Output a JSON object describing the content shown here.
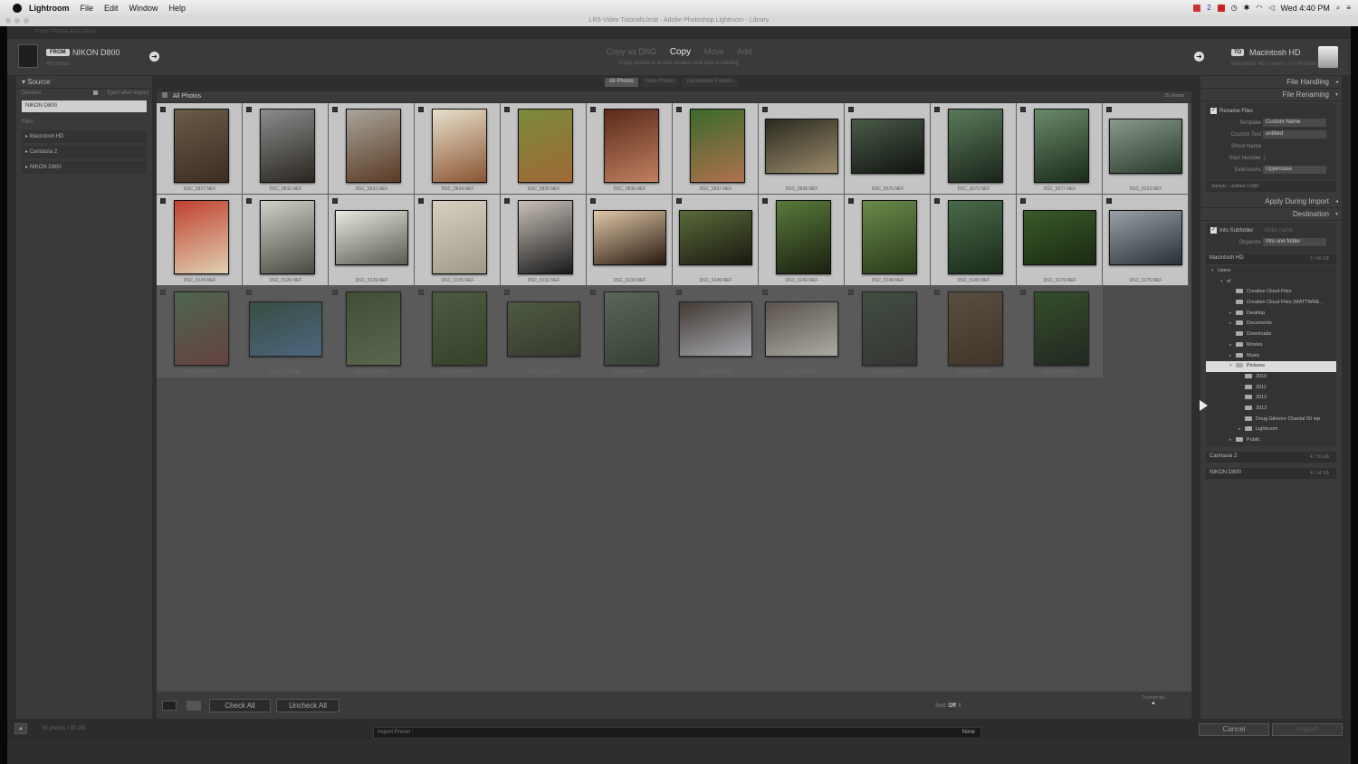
{
  "menubar": {
    "items": [
      "Lightroom",
      "File",
      "Edit",
      "Window",
      "Help"
    ],
    "clock": "Wed 4:40 PM",
    "badge": "2"
  },
  "window": {
    "title": "LR5-Video Tutorials.lrcat - Adobe Photoshop Lightroom - Library"
  },
  "topstrip": {
    "text": "Import Photos and Videos"
  },
  "header": {
    "from_tag": "FROM",
    "from_source": "NIKON D800",
    "from_sub": "All photos",
    "modes": [
      "Copy as DNG",
      "Copy",
      "Move",
      "Add"
    ],
    "active_mode": "Copy",
    "mode_desc": "Copy photos to a new location and add to catalog",
    "to_tag": "TO",
    "to_dest": "Macintosh HD",
    "to_sub": "Macintosh HD / Users / sf / Pictures"
  },
  "source_panel": {
    "title": "Source",
    "devices_label": "Devices",
    "eject_label": "Eject after import",
    "selected_device": "NIKON D800",
    "files_label": "Files",
    "volumes": [
      "Macintosh HD",
      "Camtasia 2",
      "NIKON D800"
    ]
  },
  "grid": {
    "view_tabs": [
      "All Photos",
      "New Photos",
      "Destination Folders"
    ],
    "active_tab": "All Photos",
    "header_label": "All Photos",
    "count": "35 photos",
    "photos": [
      {
        "name": "DSC_5827.NEF",
        "o": "p",
        "c1": "#6a5a48",
        "c2": "#3b2e22",
        "checked": true
      },
      {
        "name": "DSC_5832.NEF",
        "o": "p",
        "c1": "#8a8d8c",
        "c2": "#2a2520",
        "checked": true
      },
      {
        "name": "DSC_5833.NEF",
        "o": "p",
        "c1": "#a8a49a",
        "c2": "#5a3a24",
        "checked": true
      },
      {
        "name": "DSC_5834.NEF",
        "o": "p",
        "c1": "#e8e0cc",
        "c2": "#8a5532",
        "checked": true
      },
      {
        "name": "DSC_5835.NEF",
        "o": "p",
        "c1": "#7a8a3a",
        "c2": "#a06838",
        "checked": true
      },
      {
        "name": "DSC_5836.NEF",
        "o": "p",
        "c1": "#5a2a1a",
        "c2": "#c08060",
        "checked": true
      },
      {
        "name": "DSC_5837.NEF",
        "o": "p",
        "c1": "#3a6a2a",
        "c2": "#b07050",
        "checked": true
      },
      {
        "name": "DSC_5838.NEF",
        "o": "l",
        "c1": "#2a2a20",
        "c2": "#9a8a6a",
        "checked": true
      },
      {
        "name": "DSC_6070.NEF",
        "o": "l",
        "c1": "#4a5a48",
        "c2": "#101410",
        "checked": true
      },
      {
        "name": "DSC_6072.NEF",
        "o": "p",
        "c1": "#5a7a5a",
        "c2": "#1a241a",
        "checked": true
      },
      {
        "name": "DSC_6077.NEF",
        "o": "p",
        "c1": "#6a8a6a",
        "c2": "#1a2a1a",
        "checked": true
      },
      {
        "name": "DSC_6123.NEF",
        "o": "l",
        "c1": "#8a9a8a",
        "c2": "#2a3a2a",
        "checked": true
      },
      {
        "name": "DSC_6124.NEF",
        "o": "p",
        "c1": "#c04030",
        "c2": "#e0d0b0",
        "checked": true
      },
      {
        "name": "DSC_6126.NEF",
        "o": "p",
        "c1": "#d0d0c8",
        "c2": "#4a4a40",
        "checked": true
      },
      {
        "name": "DSC_6129.NEF",
        "o": "l",
        "c1": "#e8e8e0",
        "c2": "#5a5a50",
        "checked": true
      },
      {
        "name": "DSC_6130.NEF",
        "o": "p",
        "c1": "#d8d0c0",
        "c2": "#a09888",
        "checked": true
      },
      {
        "name": "DSC_6132.NEF",
        "o": "p",
        "c1": "#c8c0b8",
        "c2": "#1a1a1a",
        "checked": true
      },
      {
        "name": "DSC_6133.NEF",
        "o": "l",
        "c1": "#e0c8a8",
        "c2": "#2a1a10",
        "checked": true
      },
      {
        "name": "DSC_6140.NEF",
        "o": "l",
        "c1": "#5a6a3a",
        "c2": "#1a1a10",
        "checked": true
      },
      {
        "name": "DSC_6142.NEF",
        "o": "p",
        "c1": "#5a7a3a",
        "c2": "#1a2010",
        "checked": true
      },
      {
        "name": "DSC_6148.NEF",
        "o": "p",
        "c1": "#6a8a4a",
        "c2": "#2a3a1a",
        "checked": true
      },
      {
        "name": "DSC_6165.NEF",
        "o": "p",
        "c1": "#4a6a4a",
        "c2": "#1a2a1a",
        "checked": true
      },
      {
        "name": "DSC_6170.NEF",
        "o": "l",
        "c1": "#3a5a2a",
        "c2": "#1a2a10",
        "checked": true
      },
      {
        "name": "DSC_6175.NEF",
        "o": "l",
        "c1": "#9aa0a8",
        "c2": "#2a3038",
        "checked": true
      },
      {
        "name": "DSC_7165.NEF",
        "o": "p",
        "c1": "#4a6a4a",
        "c2": "#6a3a3a",
        "checked": false
      },
      {
        "name": "DSC_7173.NEF",
        "o": "l",
        "c1": "#2a4a3a",
        "c2": "#4a6a8a",
        "checked": false
      },
      {
        "name": "DSC_7176.NEF",
        "o": "p",
        "c1": "#3a4a2a",
        "c2": "#5a6a4a",
        "checked": false
      },
      {
        "name": "DSC_7184.NEF",
        "o": "p",
        "c1": "#4a5a3a",
        "c2": "#2a3a1a",
        "checked": false
      },
      {
        "name": "DSC_7191.NEF",
        "o": "l",
        "c1": "#4a5a3a",
        "c2": "#2a3020",
        "checked": false
      },
      {
        "name": "DSC_7194.NEF",
        "o": "p",
        "c1": "#5a6a5a",
        "c2": "#2a3a2a",
        "checked": false
      },
      {
        "name": "DSC_7210.NEF",
        "o": "l",
        "c1": "#3a3028",
        "c2": "#c0c0c8",
        "checked": false
      },
      {
        "name": "DSC_7215.NEF",
        "o": "l",
        "c1": "#5a5048",
        "c2": "#c8c4bc",
        "checked": false
      },
      {
        "name": "DSC_7229.NEF",
        "o": "p",
        "c1": "#3a4a3a",
        "c2": "#2a2a28",
        "checked": false
      },
      {
        "name": "DSC_7238.NEF",
        "o": "p",
        "c1": "#5a4a3a",
        "c2": "#3a2a1a",
        "checked": false
      },
      {
        "name": "DSC_7242.NEF",
        "o": "p",
        "c1": "#2a4a1a",
        "c2": "#101810",
        "checked": false
      }
    ]
  },
  "toolbar": {
    "check_all": "Check All",
    "uncheck_all": "Uncheck All",
    "sort_label": "Sort:",
    "sort_value": "Off",
    "thumbnails_label": "Thumbnails"
  },
  "right_panel": {
    "file_handling": "File Handling",
    "file_renaming": "File Renaming",
    "rename_files": "Rename Files",
    "template_label": "Template",
    "template_value": "Custom Name",
    "custom_text_label": "Custom Text",
    "custom_text_value": "untitled",
    "shoot_name_label": "Shoot Name",
    "start_number_label": "Start Number",
    "start_number_value": "1",
    "extensions_label": "Extensions",
    "extensions_value": "Uppercase",
    "sample": "Sample : untitled-1.NEF",
    "apply_during_import": "Apply During Import",
    "destination": "Destination",
    "into_subfolder": "Into Subfolder",
    "subfolder_placeholder": "Enter name",
    "organize_label": "Organize",
    "organize_value": "Into one folder",
    "volumes": [
      {
        "name": "Macintosh HD",
        "size": "2 / 40 GB"
      },
      {
        "name": "Camtasia 2",
        "size": "4 / 36 GB"
      },
      {
        "name": "NIKON D800",
        "size": "4 / 14 GB"
      }
    ],
    "tree": [
      {
        "label": "Users",
        "depth": 0,
        "tri": "▾",
        "folder": false
      },
      {
        "label": "sf",
        "depth": 1,
        "tri": "▾",
        "folder": false
      },
      {
        "label": "Creative Cloud Files",
        "depth": 2,
        "tri": "",
        "folder": true
      },
      {
        "label": "Creative Cloud Files (MATTWHE...",
        "depth": 2,
        "tri": "",
        "folder": true
      },
      {
        "label": "Desktop",
        "depth": 2,
        "tri": "▸",
        "folder": true
      },
      {
        "label": "Documents",
        "depth": 2,
        "tri": "▸",
        "folder": true
      },
      {
        "label": "Downloads",
        "depth": 2,
        "tri": "",
        "folder": true
      },
      {
        "label": "Movies",
        "depth": 2,
        "tri": "▸",
        "folder": true
      },
      {
        "label": "Music",
        "depth": 2,
        "tri": "▸",
        "folder": true
      },
      {
        "label": "Pictures",
        "depth": 2,
        "tri": "▾",
        "folder": true,
        "selected": true
      },
      {
        "label": "2010",
        "depth": 3,
        "tri": "",
        "folder": true
      },
      {
        "label": "2011",
        "depth": 3,
        "tri": "",
        "folder": true
      },
      {
        "label": "2012",
        "depth": 3,
        "tri": "",
        "folder": true
      },
      {
        "label": "2013",
        "depth": 3,
        "tri": "",
        "folder": true
      },
      {
        "label": "Doug Gilmore Chantal 50 mp",
        "depth": 3,
        "tri": "",
        "folder": true
      },
      {
        "label": "Lightroom",
        "depth": 3,
        "tri": "▸",
        "folder": true
      },
      {
        "label": "Public",
        "depth": 2,
        "tri": "▸",
        "folder": true
      }
    ]
  },
  "bottom": {
    "summary": "35 photos / 30 GB",
    "preset_label": "Import Preset :",
    "preset_value": "None",
    "cancel": "Cancel",
    "import": "Import"
  }
}
